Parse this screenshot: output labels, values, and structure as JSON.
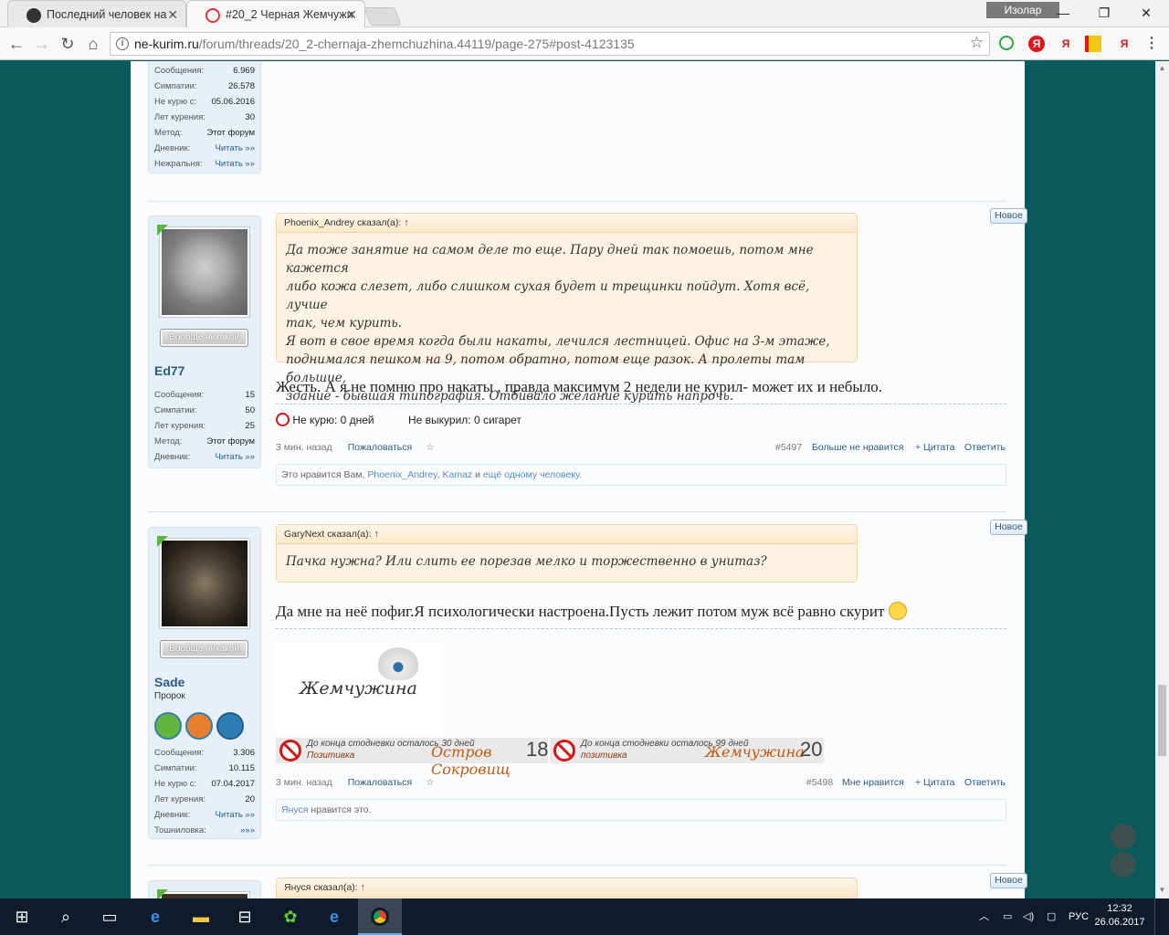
{
  "browser": {
    "tabs": [
      {
        "title": "Последний человек на   ",
        "active": false
      },
      {
        "title": "#20_2 Черная Жемчужи",
        "active": true
      }
    ],
    "user_label": "Изолар",
    "url_host": "ne-kurim.ru",
    "url_path": "/forum/threads/20_2-chernaja-zhemchuzhina.44119/page-275#post-4123135",
    "ext_labels": [
      "Я",
      "Я",
      "Я"
    ]
  },
  "posts": [
    {
      "id": "prev",
      "stats": [
        {
          "label": "Сообщения:",
          "value": "6.969"
        },
        {
          "label": "Симпатии:",
          "value": "26.578"
        },
        {
          "label": "Не курю с:",
          "value": "05.06.2016"
        },
        {
          "label": "Лет курения:",
          "value": "30"
        },
        {
          "label": "Метод:",
          "value": "Этот форум"
        },
        {
          "label": "Дневник:",
          "value": "Читать »»"
        },
        {
          "label": "Нежральня:",
          "value": "Читать »»"
        }
      ]
    },
    {
      "id": "p5497",
      "username": "Ed77",
      "rank": "Вообще никакой",
      "stats": [
        {
          "label": "Сообщения:",
          "value": "15"
        },
        {
          "label": "Симпатии:",
          "value": "50"
        },
        {
          "label": "Лет курения:",
          "value": "25"
        },
        {
          "label": "Метод:",
          "value": "Этот форум"
        },
        {
          "label": "Дневник:",
          "value": "Читать »»"
        }
      ],
      "badge": "Новое",
      "quote_head": "Phoenix_Andrey сказал(а): ↑",
      "quote_lines": [
        "Да тоже занятие на самом деле то еще. Пару дней так помоешь, потом мне кажется",
        "либо кожа слезет, либо слишком сухая будет и трещинки пойдут. Хотя всё, лучше",
        "так, чем курить.",
        "Я вот в свое время когда были накаты, лечился лестницей. Офис на 3-м этаже,",
        "поднимался пешком на 9, потом обратно, потом еще разок. А пролеты там большие,",
        "здание - бывшая типография. Отбивало желание курить напрочь."
      ],
      "message": "Жесть. А я не помню про накаты , правда максимум 2 недели не курил- может их и небыло.",
      "sig_1": "Не курю: 0 дней",
      "sig_2": "Не выкурил: 0 сигарет",
      "time": "3 мин. назад",
      "report": "Пожаловаться",
      "number": "#5497",
      "like": "Больше не нравится",
      "quote": "+ Цитата",
      "reply": "Ответить",
      "likes_prefix": "Это нравится Вам, ",
      "likes_n1": "Phoenix_Andrey",
      "likes_sep": ", ",
      "likes_n2": "Kamaz",
      "likes_mid": " и ",
      "likes_n3": "ещё одному человеку",
      "likes_end": "."
    },
    {
      "id": "p5498",
      "username": "Sade",
      "title": "Пророк",
      "rank": "Вообще никакой",
      "stats": [
        {
          "label": "Сообщения:",
          "value": "3.306"
        },
        {
          "label": "Симпатии:",
          "value": "10.115"
        },
        {
          "label": "Не курю с:",
          "value": "07.04.2017"
        },
        {
          "label": "Лет курения:",
          "value": "20"
        },
        {
          "label": "Дневник:",
          "value": "Читать »»"
        },
        {
          "label": "Тошниловка:",
          "value": "»»»"
        }
      ],
      "badge": "Новое",
      "quote_head": "GaryNext сказал(а): ↑",
      "quote_lines": [
        "Пачка нужна? Или слить ее порезав мелко и торжественно в унитаз?"
      ],
      "message": "Да мне на неё пофиг.Я психологически настроена.Пусть лежит потом муж всё равно скурит",
      "sig_logo": "Жемчужина",
      "banner1": {
        "line1": "До конца стодневки осталось 30 дней",
        "line2": "Позитивка",
        "big": "Остров Сокровищ",
        "num": "18"
      },
      "banner2": {
        "line1": "До конца стодневки осталось 99 дней",
        "line2": "позитивка",
        "big": "Жемчужина",
        "num": "20"
      },
      "time": "3 мин. назад",
      "report": "Пожаловаться",
      "number": "#5498",
      "like": "Мне нравится",
      "quote": "+ Цитата",
      "reply": "Ответить",
      "likes_n1": "Януся",
      "likes_end": " нравится это."
    },
    {
      "id": "next",
      "badge": "Новое",
      "quote_head": "Януся сказал(а): ↑"
    }
  ],
  "taskbar": {
    "lang": "РУС",
    "time": "12:32",
    "date": "26.06.2017"
  },
  "colors": {
    "page_bg": "#0a5a5c",
    "link": "#2a5c8a",
    "quote_bg": "#fdf2e1"
  }
}
